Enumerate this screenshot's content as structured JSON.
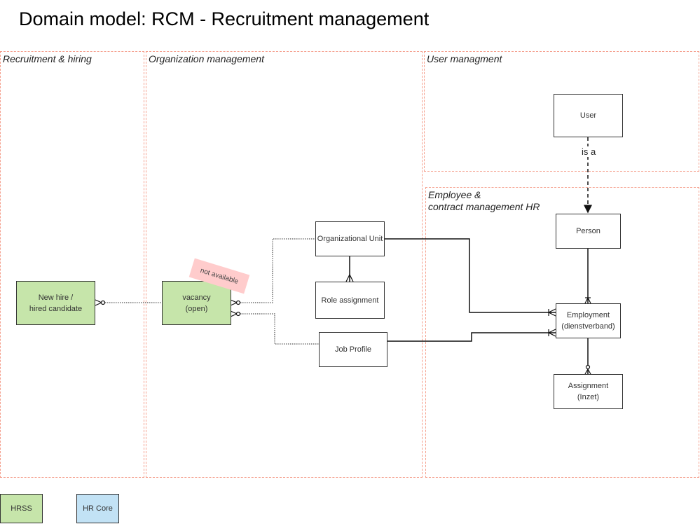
{
  "title": "Domain model: RCM - Recruitment management",
  "lanes": {
    "recruitment": "Recruitment & hiring",
    "organization": "Organization management",
    "user": "User managment",
    "employee_line1": "Employee &",
    "employee_line2": "contract management HR"
  },
  "entities": {
    "new_hire_l1": "New hire /",
    "new_hire_l2": "hired candidate",
    "vacancy_l1": "vacancy",
    "vacancy_l2": "(open)",
    "org_unit": "Organizational Unit",
    "role_assignment": "Role assignment",
    "job_profile": "Job Profile",
    "user": "User",
    "person": "Person",
    "employment_l1": "Employment",
    "employment_l2": "(dienstverband)",
    "assignment_l1": "Assignment",
    "assignment_l2": "(Inzet)"
  },
  "note": "not available",
  "edge_labels": {
    "is_a": "is a"
  },
  "legend": {
    "hrss": "HRSS",
    "hr_core": "HR Core"
  },
  "colors": {
    "hrss": "#c6e5aa",
    "hr_core": "#c2e2f5",
    "lane_border": "#f5a08e",
    "note": "#ffcccc"
  }
}
